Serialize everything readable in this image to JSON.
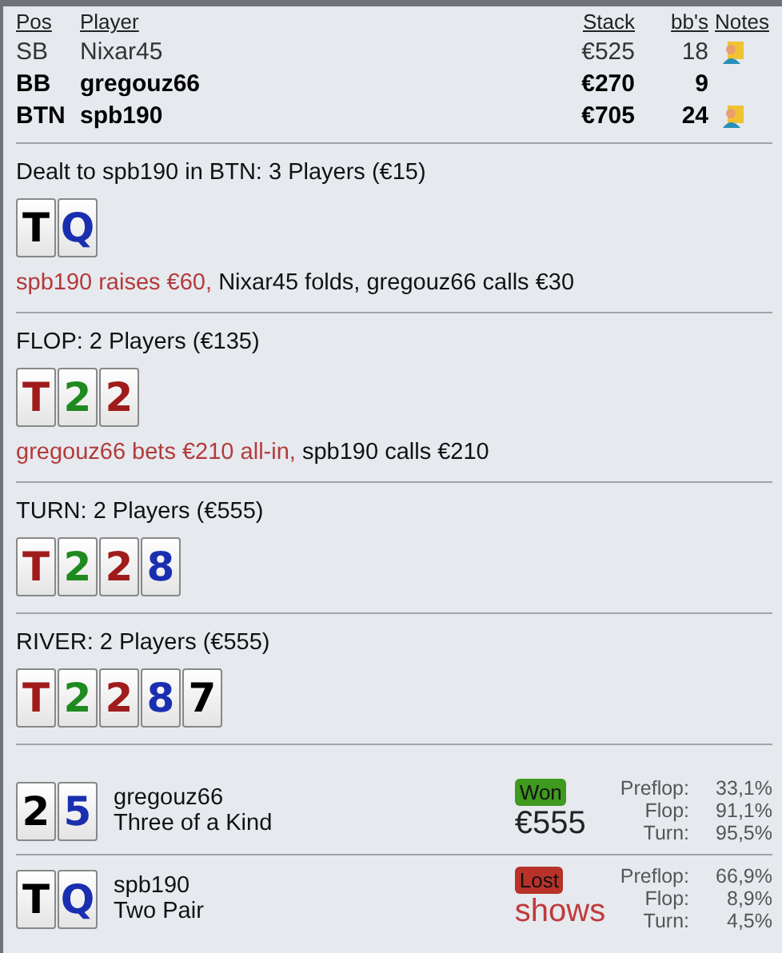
{
  "players": {
    "columns": [
      "Pos",
      "Player",
      "Stack",
      "bb's",
      "Notes"
    ],
    "rows": [
      {
        "pos": "SB",
        "name": "Nixar45",
        "stack": "€525",
        "bbs": "18",
        "bold": false,
        "has_note": true
      },
      {
        "pos": "BB",
        "name": "gregouz66",
        "stack": "€270",
        "bbs": "9",
        "bold": true,
        "has_note": false
      },
      {
        "pos": "BTN",
        "name": "spb190",
        "stack": "€705",
        "bbs": "24",
        "bold": true,
        "has_note": true
      }
    ]
  },
  "streets": [
    {
      "title": "Dealt to spb190 in BTN: 3 Players (€15)",
      "cards": [
        {
          "rank": "T",
          "color": "#000000"
        },
        {
          "rank": "Q",
          "color": "#1a2fb0"
        }
      ],
      "actions": [
        {
          "text": "spb190 raises €60,",
          "highlight": true
        },
        {
          "text": "Nixar45 folds, gregouz66 calls €30",
          "highlight": false
        }
      ]
    },
    {
      "title": "FLOP: 2 Players (€135)",
      "cards": [
        {
          "rank": "T",
          "color": "#a01c1c"
        },
        {
          "rank": "2",
          "color": "#1f8a1f"
        },
        {
          "rank": "2",
          "color": "#a01c1c"
        }
      ],
      "actions": [
        {
          "text": "gregouz66 bets €210 all-in,",
          "highlight": true
        },
        {
          "text": "spb190 calls €210",
          "highlight": false
        }
      ]
    },
    {
      "title": "TURN: 2 Players (€555)",
      "cards": [
        {
          "rank": "T",
          "color": "#a01c1c"
        },
        {
          "rank": "2",
          "color": "#1f8a1f"
        },
        {
          "rank": "2",
          "color": "#a01c1c"
        },
        {
          "rank": "8",
          "color": "#1a2fb0"
        }
      ]
    },
    {
      "title": "RIVER: 2 Players (€555)",
      "cards": [
        {
          "rank": "T",
          "color": "#a01c1c"
        },
        {
          "rank": "2",
          "color": "#1f8a1f"
        },
        {
          "rank": "2",
          "color": "#a01c1c"
        },
        {
          "rank": "8",
          "color": "#1a2fb0"
        },
        {
          "rank": "7",
          "color": "#000000"
        }
      ]
    }
  ],
  "results": [
    {
      "cards": [
        {
          "rank": "2",
          "color": "#000000"
        },
        {
          "rank": "5",
          "color": "#1a2fb0"
        }
      ],
      "name": "gregouz66",
      "hand": "Three of a Kind",
      "kind": "won",
      "badge": "Won",
      "outcome": "€555",
      "equity": [
        {
          "label": "Preflop:",
          "value": "33,1%"
        },
        {
          "label": "Flop:",
          "value": "91,1%"
        },
        {
          "label": "Turn:",
          "value": "95,5%"
        }
      ]
    },
    {
      "cards": [
        {
          "rank": "T",
          "color": "#000000"
        },
        {
          "rank": "Q",
          "color": "#1a2fb0"
        }
      ],
      "name": "spb190",
      "hand": "Two Pair",
      "kind": "lost",
      "badge": "Lost",
      "outcome": "shows",
      "equity": [
        {
          "label": "Preflop:",
          "value": "66,9%"
        },
        {
          "label": "Flop:",
          "value": "8,9%"
        },
        {
          "label": "Turn:",
          "value": "4,5%"
        }
      ]
    }
  ]
}
